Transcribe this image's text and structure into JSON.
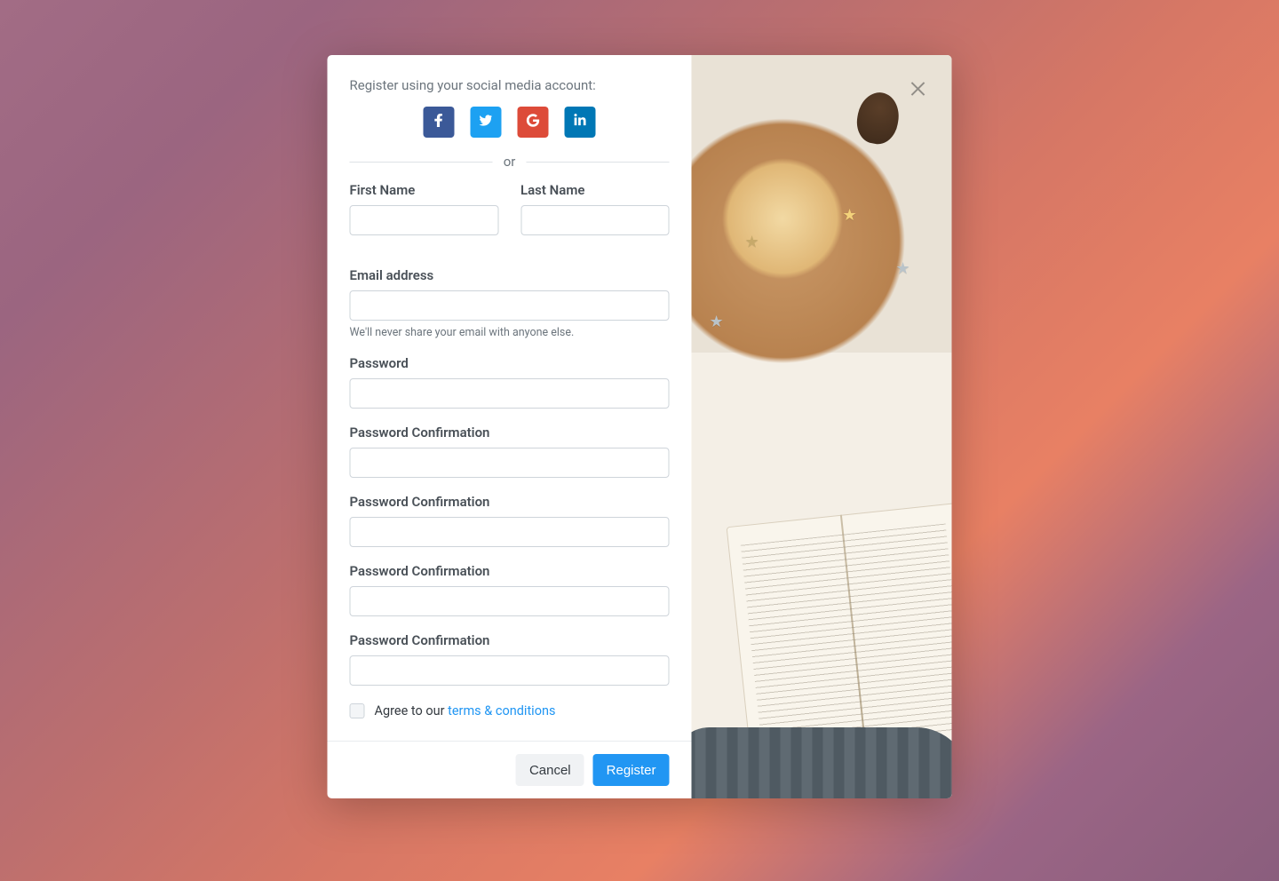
{
  "modal": {
    "social_title": "Register using your social media account:",
    "divider": "or",
    "labels": {
      "first_name": "First Name",
      "last_name": "Last Name",
      "email": "Email address",
      "password": "Password",
      "password_confirm_1": "Password Confirmation",
      "password_confirm_2": "Password Confirmation",
      "password_confirm_3": "Password Confirmation",
      "password_confirm_4": "Password Confirmation"
    },
    "email_hint": "We'll never share your email with anyone else.",
    "terms_prefix": "Agree to our ",
    "terms_link": "terms & conditions",
    "buttons": {
      "cancel": "Cancel",
      "register": "Register"
    },
    "social": {
      "facebook": "facebook-icon",
      "twitter": "twitter-icon",
      "google": "google-icon",
      "linkedin": "linkedin-icon"
    }
  }
}
